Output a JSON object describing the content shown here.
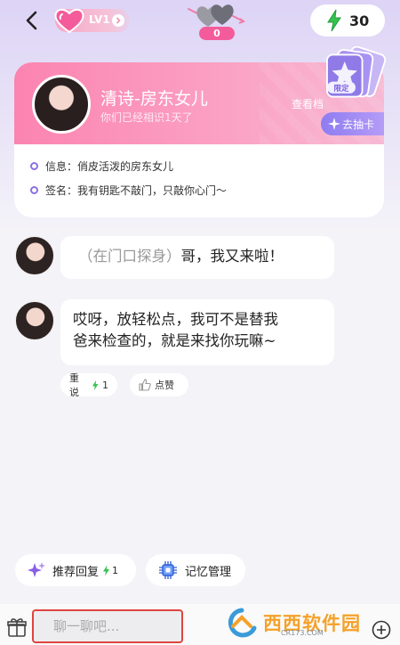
{
  "header": {
    "level": "LV1",
    "hearts_count": "0",
    "energy": "30"
  },
  "profile": {
    "name": "清诗-房东女儿",
    "subtitle": "你们已经相识1天了",
    "see_more": "查看档",
    "gacha_button": "去抽卡",
    "card_badge": "限定",
    "info_label": "信息：",
    "info_value": "俏皮活泼的房东女儿",
    "sign_label": "签名：",
    "sign_value": "我有钥匙不敲门，只敲你心门～"
  },
  "messages": [
    {
      "action": "（在门口探身）",
      "text": "哥，我又来啦！"
    },
    {
      "line1": "哎呀，放轻松点，我可不是替我",
      "line2": "爸来检查的，就是来找你玩嘛~"
    }
  ],
  "message_actions": {
    "reroll": "重说",
    "reroll_cost": "1",
    "like": "点赞"
  },
  "suggestions": {
    "recommend": "推荐回复",
    "recommend_cost": "1",
    "memory": "记忆管理"
  },
  "input": {
    "placeholder": "聊一聊吧..."
  },
  "watermark": {
    "title": "西西软件园",
    "url": "CR173.COM"
  },
  "colors": {
    "accent_pink": "#f45b9a",
    "accent_purple": "#8b6fe4",
    "energy_green": "#36c24f",
    "input_border": "#e0443f"
  }
}
